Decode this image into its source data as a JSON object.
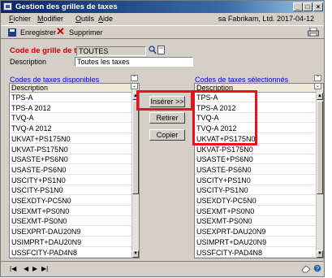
{
  "window": {
    "title": "Gestion des grilles de taxes"
  },
  "menu": {
    "items": [
      "Fichier",
      "Modifier",
      "Outils",
      "Aide"
    ],
    "company": "sa  Fabrikam, Ltd.  2017-04-12"
  },
  "toolbar": {
    "save_label": "Enregistrer",
    "delete_label": "Supprimer"
  },
  "form": {
    "code_label": "Code de grille de ta",
    "code_value": "TOUTES",
    "desc_label": "Description",
    "desc_value": "Toutes les taxes"
  },
  "available": {
    "heading": "Codes de taxes disponibles",
    "column": "Description",
    "rows": [
      "TPS-A",
      "TPS-A 2012",
      "TVQ-A",
      "TVQ-A 2012",
      "UKVAT+PS175N0",
      "UKVAT-PS175N0",
      "USASTE+PS6N0",
      "USASTE-PS6N0",
      "USCITY+PS1N0",
      "USCITY-PS1N0",
      "USEXDTY-PC5N0",
      "USEXMT+PS0N0",
      "USEXMT-PS0N0",
      "USEXPRT-DAU20N9",
      "USIMPRT+DAU20N9",
      "USSFCITY-PAD4N8"
    ]
  },
  "actions": {
    "insert": "Insérer >>",
    "remove": "Retirer",
    "copy": "Copier"
  },
  "selected": {
    "heading": "Codes de taxes sélectionnés",
    "column": "Description",
    "rows": [
      "TPS-A",
      "TPS-A 2012",
      "TVQ-A",
      "TVQ-A 2012",
      "UKVAT+PS175N0",
      "UKVAT-PS175N0",
      "USASTE+PS6N0",
      "USASTE-PS6N0",
      "USCITY+PS1N0",
      "USCITY-PS1N0",
      "USEXDTY-PC5N0",
      "USEXMT+PS0N0",
      "USEXMT-PS0N0",
      "USEXPRT-DAU20N9",
      "USIMPRT+DAU20N9",
      "USSFCITY-PAD4N8"
    ]
  },
  "colors": {
    "highlight": "#e8111d",
    "link": "#0000ee",
    "required": "#cc0000"
  }
}
